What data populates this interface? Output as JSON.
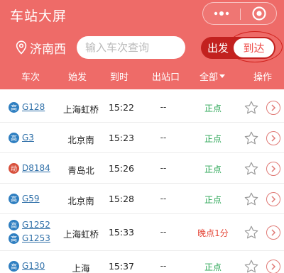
{
  "header": {
    "title": "车站大屏",
    "capsule": {
      "more_icon": "more-dots-icon",
      "close_icon": "record-circle-icon"
    },
    "station": {
      "icon": "location-pin-icon",
      "name": "济南西"
    },
    "search": {
      "placeholder": "输入车次查询",
      "value": ""
    },
    "toggle": {
      "departure_label": "出发",
      "arrival_label": "到达",
      "selected": "到达"
    }
  },
  "columns": {
    "train": "车次",
    "origin": "始发",
    "arrival_time": "到时",
    "exit_gate": "出站口",
    "filter": "全部",
    "actions": "操作"
  },
  "colors": {
    "header": "#ee6b68",
    "toggle_bg": "#c2211f",
    "on_time": "#2aa655",
    "late": "#e5493a",
    "link": "#2e6fa8",
    "badge_g": "#2f7fc1",
    "badge_d": "#d8503c"
  },
  "trains": [
    {
      "lines": [
        {
          "badge": "高",
          "no": "G128"
        }
      ],
      "origin": "上海虹桥",
      "arrival": "15:22",
      "gate": "--",
      "status": "正点",
      "status_type": "on_time"
    },
    {
      "lines": [
        {
          "badge": "高",
          "no": "G3"
        }
      ],
      "origin": "北京南",
      "arrival": "15:23",
      "gate": "--",
      "status": "正点",
      "status_type": "on_time"
    },
    {
      "lines": [
        {
          "badge": "动",
          "no": "D8184"
        }
      ],
      "origin": "青岛北",
      "arrival": "15:26",
      "gate": "--",
      "status": "正点",
      "status_type": "on_time"
    },
    {
      "lines": [
        {
          "badge": "高",
          "no": "G59"
        }
      ],
      "origin": "北京南",
      "arrival": "15:28",
      "gate": "--",
      "status": "正点",
      "status_type": "on_time"
    },
    {
      "lines": [
        {
          "badge": "高",
          "no": "G1252"
        },
        {
          "badge": "高",
          "no": "G1253"
        }
      ],
      "origin": "上海虹桥",
      "arrival": "15:33",
      "gate": "--",
      "status": "晚点1分",
      "status_type": "late"
    },
    {
      "lines": [
        {
          "badge": "高",
          "no": "G130"
        }
      ],
      "origin": "上海",
      "arrival": "15:37",
      "gate": "--",
      "status": "正点",
      "status_type": "on_time"
    }
  ]
}
